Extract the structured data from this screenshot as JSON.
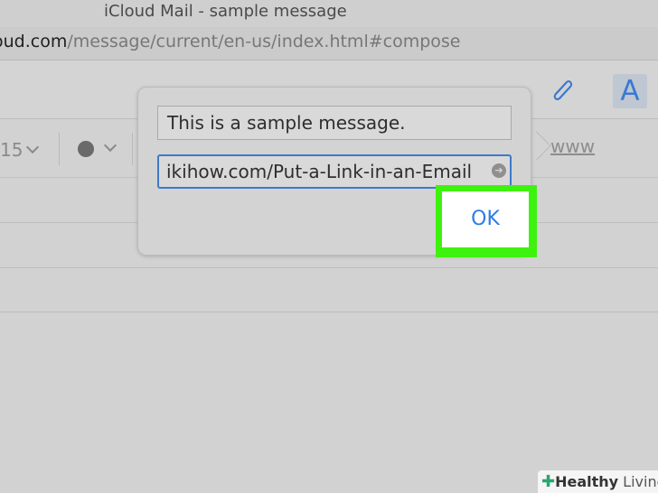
{
  "window": {
    "title": "iCloud Mail - sample message"
  },
  "address_bar": {
    "host": "oud.com",
    "path": "/message/current/en-us/index.html#compose"
  },
  "format_bar": {
    "font_size": "15",
    "link_text": "www"
  },
  "toolbar": {
    "font_button": "A"
  },
  "link_popover": {
    "text_value": "This is a sample message.",
    "url_value": "ikihow.com/Put-a-Link-in-an-Email",
    "go_icon": "➔",
    "ok_label": "OK"
  },
  "watermark": {
    "name_bold": "Healthy",
    "name_rest": " Living"
  },
  "colors": {
    "highlight": "#3ef20f",
    "accent": "#2b7de9",
    "field_focus": "#3f79c9"
  }
}
